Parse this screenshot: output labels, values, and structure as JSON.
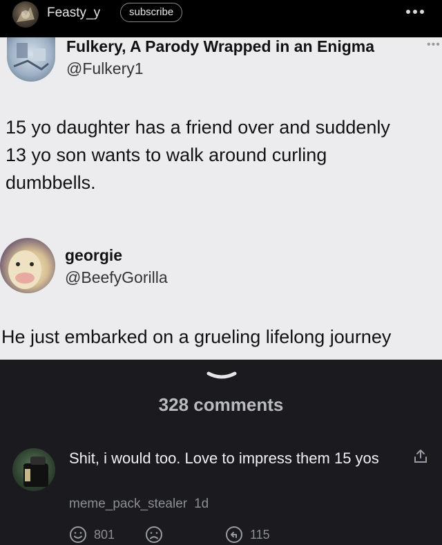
{
  "header": {
    "poster_name": "Feasty_y",
    "subscribe_label": "subscribe",
    "more_icon": "more-dots-icon"
  },
  "meme": {
    "tweet1": {
      "name": "Fulkery, A Parody Wrapped in an Enigma",
      "handle": "@Fulkery1",
      "body_lines": [
        "15 yo daughter has a friend over and suddenly",
        "13 yo son wants to walk around curling",
        "dumbbells."
      ]
    },
    "tweet2": {
      "name": "georgie",
      "handle": "@BeefyGorilla",
      "body": "He just embarked on a grueling lifelong journey"
    }
  },
  "comments": {
    "count_label": "328 comments",
    "items": [
      {
        "text": "Shit, i would too. Love to impress them 15 yos",
        "author": "meme_pack_stealer",
        "age": "1d",
        "likes": "801",
        "replies": "115"
      }
    ]
  },
  "colors": {
    "page_bg": "#000000",
    "meme_bg": "#ececef",
    "comments_bg": "#1b1b1f",
    "muted_text": "#8b8e96"
  }
}
